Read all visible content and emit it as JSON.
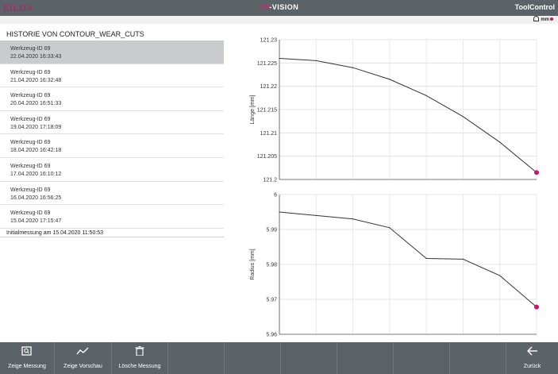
{
  "header": {
    "logo": "EILDA",
    "title_accent": "LS",
    "title_rest": "-VISION",
    "app_name": "ToolControl",
    "unit": "mm"
  },
  "history": {
    "title": "HISTORIE VON CONTOUR_WEAR_CUTS",
    "items": [
      {
        "name": "Werkzeug-ID 69",
        "date": "22.04.2020 16:33:43"
      },
      {
        "name": "Werkzeug-ID 69",
        "date": "21.04.2020 16:32:48"
      },
      {
        "name": "Werkzeug-ID 69",
        "date": "20.04.2020 16:51:33"
      },
      {
        "name": "Werkzeug-ID 69",
        "date": "19.04.2020 17:18:09"
      },
      {
        "name": "Werkzeug-ID 69",
        "date": "18.04.2020 16:42:18"
      },
      {
        "name": "Werkzeug-ID 69",
        "date": "17.04.2020 16:10:12"
      },
      {
        "name": "Werkzeug-ID 69",
        "date": "16.04.2020 16:56:25"
      },
      {
        "name": "Werkzeug-ID 69",
        "date": "15.04.2020 17:15:47"
      }
    ],
    "initial": "Initialmessung am 15.04.2020 11:50:53"
  },
  "chart_data": [
    {
      "type": "line",
      "ylabel": "Länge [mm]",
      "ylim": [
        121.2,
        121.23
      ],
      "yticks": [
        "121.23",
        "121.225",
        "121.22",
        "121.215",
        "121.21",
        "121.205",
        "121.2"
      ],
      "values": [
        121.226,
        121.2255,
        121.224,
        121.2215,
        121.218,
        121.2135,
        121.208,
        121.2015
      ],
      "marker": "last-point",
      "marker_color": "#d0106f",
      "grid": true
    },
    {
      "type": "line",
      "ylabel": "Radius [mm]",
      "ylim": [
        5.96,
        6
      ],
      "yticks": [
        "6",
        "5.99",
        "5.98",
        "5.97",
        "5.96"
      ],
      "values": [
        5.995,
        5.994,
        5.993,
        5.9905,
        5.9817,
        5.9815,
        5.9768,
        5.9678
      ],
      "marker": "last-point",
      "marker_color": "#d0106f",
      "grid": true
    }
  ],
  "footer": {
    "show_measurement": "Zeige Messung",
    "show_preview": "Zeige Vorschau",
    "delete_measurement": "Lösche Messung",
    "back": "Zurück"
  }
}
